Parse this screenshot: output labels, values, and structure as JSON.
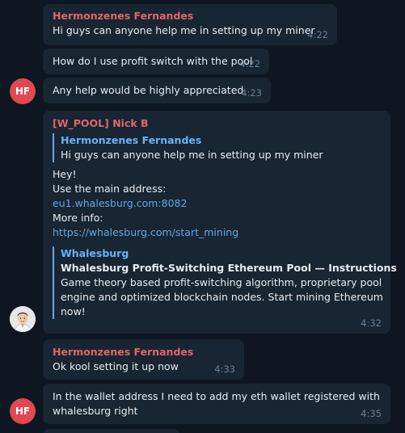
{
  "colors": {
    "background": "#0e1621",
    "bubble": "#182533",
    "sender_name": "#e0666a",
    "link": "#62a8e6",
    "avatar_hf": "#e0494f"
  },
  "messages": [
    {
      "sender": "Hermonzenes Fernandes",
      "text": "Hi guys can anyone help me in setting up my miner",
      "time": "4:22"
    },
    {
      "text": "How do I use profit switch with the pool",
      "time": "4:22"
    },
    {
      "avatar": "HF",
      "text": "Any help would be highly appreciated",
      "time": "4:23"
    },
    {
      "sender": "[W_POOL] Nick B",
      "reply": {
        "name": "Hermonzenes Fernandes",
        "text": "Hi guys can anyone help me in setting up my miner"
      },
      "lines": [
        "Hey!",
        "Use the main address:"
      ],
      "address_link": "eu1.whalesburg.com:8082",
      "more_info": "More info:",
      "info_link": "https://whalesburg.com/start_mining",
      "preview": {
        "site": "Whalesburg",
        "title": "Whalesburg Profit-Switching Ethereum Pool — Instructions",
        "description": [
          "Game theory based profit-switching algorithm, proprietary pool",
          "engine and optimized blockchain nodes. Start mining Ethereum",
          "now!"
        ]
      },
      "time": "4:32",
      "avatar_icon": "cartoon-man-avatar-icon"
    },
    {
      "sender": "Hermonzenes Fernandes",
      "text": "Ok kool setting it up now",
      "time": "4:33"
    },
    {
      "avatar": "HF",
      "lines": [
        "In the wallet address I need to add my eth wallet registered with",
        "whalesburg right"
      ],
      "time": "4:35"
    }
  ]
}
